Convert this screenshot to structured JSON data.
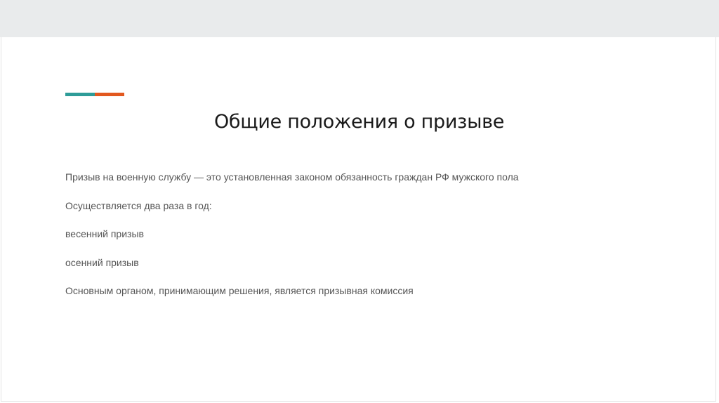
{
  "colors": {
    "accent_teal": "#2e9c98",
    "accent_orange": "#e2581f",
    "title_text": "#1a1a1a",
    "body_text": "#555555",
    "top_bar": "#e9ebec"
  },
  "slide": {
    "title": "Общие положения о призыве",
    "paragraphs": [
      "Призыв на военную службу — это установленная законом обязанность граждан РФ мужского пола",
      "Осуществляется два раза в год:",
      "весенний призыв",
      "осенний призыв",
      "Основным органом, принимающим решения, является призывная комиссия"
    ]
  }
}
